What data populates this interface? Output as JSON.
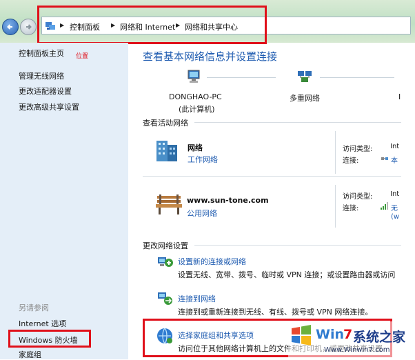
{
  "breadcrumb": [
    "控制面板",
    "网络和 Internet",
    "网络和共享中心"
  ],
  "sidebar": {
    "items": [
      "控制面板主页",
      "管理无线网络",
      "更改适配器设置",
      "更改高级共享设置"
    ],
    "note": "位置",
    "see_also_title": "另请参阅",
    "see_also": [
      "Internet 选项",
      "Windows 防火墙",
      "家庭组"
    ]
  },
  "main": {
    "title": "查看基本网络信息并设置连接",
    "map": {
      "computer_name": "DONGHAO-PC",
      "computer_sub": "(此计算机)",
      "network_label": "多重网络",
      "third_partial": "I"
    },
    "active_title": "查看活动网络",
    "networks": [
      {
        "name": "网络",
        "type": "工作网络",
        "access_label": "访问类型:",
        "access_value": "Int",
        "conn_label": "连接:",
        "conn_value": "本"
      },
      {
        "name": "www.sun-tone.com",
        "type": "公用网络",
        "access_label": "访问类型:",
        "access_value": "Int",
        "conn_label": "连接:",
        "conn_value": "无",
        "conn_value2": "(w"
      }
    ],
    "change_title": "更改网络设置",
    "tasks": [
      {
        "link": "设置新的连接或网络",
        "desc": "设置无线、宽带、拨号、临时或 VPN 连接；或设置路由器或访问"
      },
      {
        "link": "连接到网络",
        "desc": "连接到或重新连接到无线、有线、拨号或 VPN 网络连接。"
      },
      {
        "link": "选择家庭组和共享选项",
        "desc": "访问位于其他网络计算机上的文件和打印机，或更改共享设置"
      }
    ]
  },
  "watermark": {
    "part1": "Win",
    "part2": "7",
    "part3": "系统之家",
    "url": "Www.Winwin7.com"
  },
  "colors": {
    "link": "#1e5bb0",
    "highlight": "#e0101a",
    "sidebar_bg": "#e4eef8"
  }
}
